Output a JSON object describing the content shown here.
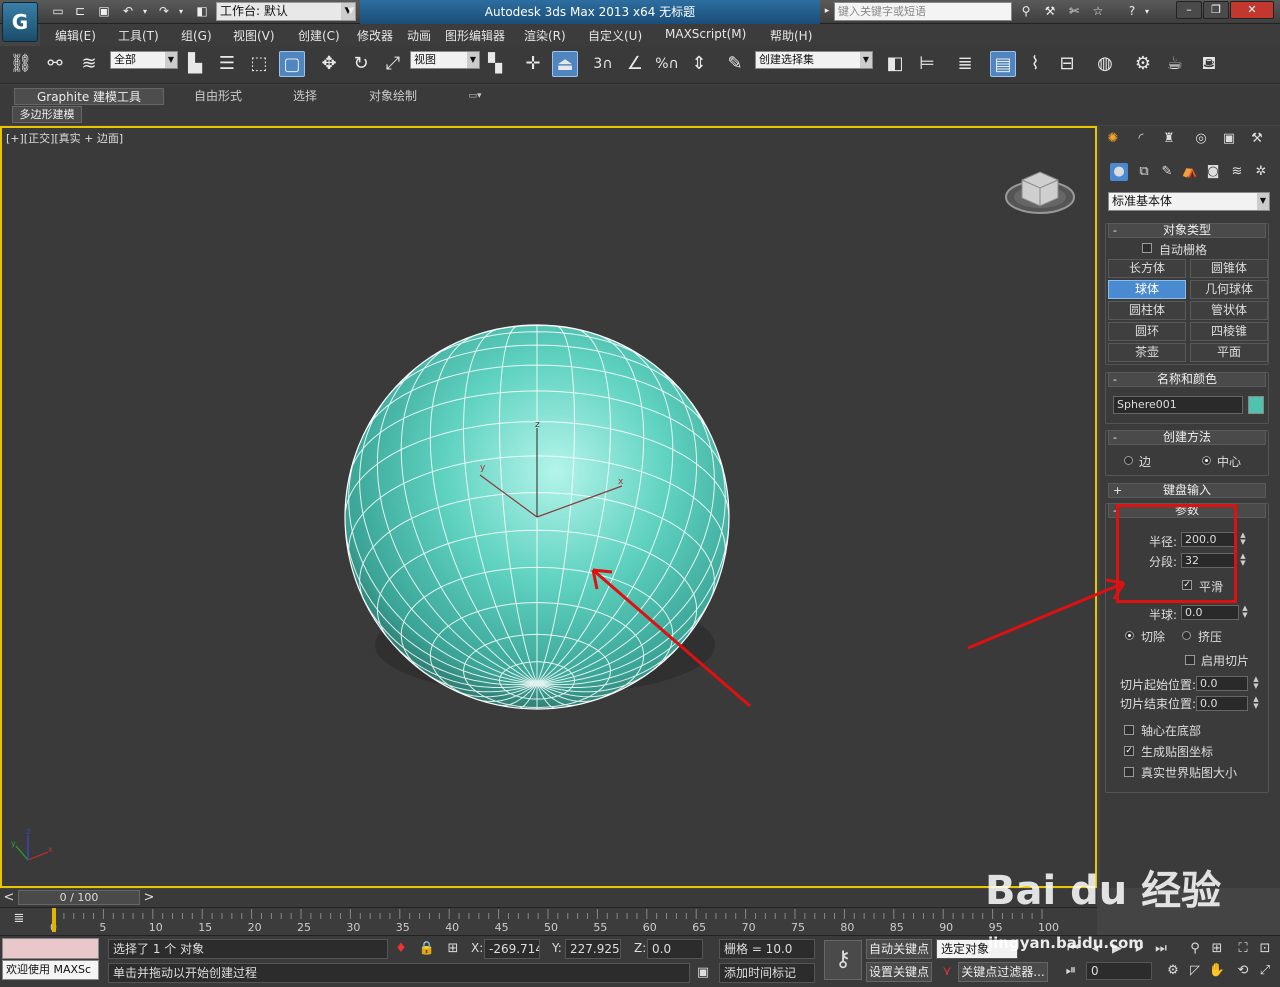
{
  "titlebar": {
    "app_title": "Autodesk 3ds Max  2013 x64",
    "file_title": "无标题",
    "workspace_label": "工作台: 默认",
    "search_placeholder": "键入关键字或短语",
    "logo": "G"
  },
  "menus": [
    "编辑(E)",
    "工具(T)",
    "组(G)",
    "视图(V)",
    "创建(C)",
    "修改器",
    "动画",
    "图形编辑器",
    "渲染(R)",
    "自定义(U)",
    "MAXScript(M)",
    "帮助(H)"
  ],
  "toolbar": {
    "selection_filter": "全部",
    "ref_coord": "视图",
    "named_selection": "创建选择集",
    "snap_label": "3",
    "angle_label": "%"
  },
  "ribbon": {
    "tabs": [
      "Graphite 建模工具",
      "自由形式",
      "选择",
      "对象绘制"
    ],
    "sub_label": "多边形建模"
  },
  "viewport": {
    "label": "[+][正交][真实 + 边面]",
    "gizmo_x": "x",
    "gizmo_y": "y",
    "gizmo_z": "z",
    "axis_x": "x",
    "axis_y": "y",
    "axis_z": "z",
    "sphere_color": "#4fc2b0"
  },
  "command_panel": {
    "category_dropdown": "标准基本体",
    "object_type": {
      "title": "对象类型",
      "autogrid": "自动栅格",
      "buttons": [
        "长方体",
        "圆锥体",
        "球体",
        "几何球体",
        "圆柱体",
        "管状体",
        "圆环",
        "四棱锥",
        "茶壶",
        "平面"
      ],
      "active": "球体"
    },
    "name_color": {
      "title": "名称和颜色",
      "name": "Sphere001",
      "color": "#4fc2b0"
    },
    "creation_method": {
      "title": "创建方法",
      "edge": "边",
      "center": "中心"
    },
    "keyboard_entry": {
      "title": "键盘输入"
    },
    "parameters": {
      "title": "参数",
      "radius_label": "半径:",
      "radius": "200.0",
      "segments_label": "分段:",
      "segments": "32",
      "smooth_label": "平滑",
      "hemisphere_label": "半球:",
      "hemisphere": "0.0",
      "chop": "切除",
      "squash": "挤压",
      "slice_on": "启用切片",
      "slice_from_label": "切片起始位置:",
      "slice_from": "0.0",
      "slice_to_label": "切片结束位置:",
      "slice_to": "0.0",
      "base_to_pivot": "轴心在底部",
      "gen_mapping": "生成贴图坐标",
      "real_world": "真实世界贴图大小"
    }
  },
  "timeline": {
    "frame_display": "0 / 100",
    "ticks": [
      "0",
      "5",
      "10",
      "15",
      "20",
      "25",
      "30",
      "35",
      "40",
      "45",
      "50",
      "55",
      "60",
      "65",
      "70",
      "75",
      "80",
      "85",
      "90",
      "95",
      "100"
    ]
  },
  "status": {
    "selection": "选择了 1 个 对象",
    "prompt": "单击并拖动以开始创建过程",
    "x_label": "X:",
    "x": "-269.714",
    "y_label": "Y:",
    "y": "227.925",
    "z_label": "Z:",
    "z": "0.0",
    "grid": "栅格 = 10.0",
    "auto_key": "自动关键点",
    "set_key": "设置关键点",
    "key_mode": "选定对象",
    "key_filters": "关键点过滤器...",
    "add_time_tag": "添加时间标记",
    "welcome": "欢迎使用 MAXSc",
    "frame": "0"
  },
  "watermark": {
    "brand": "Bai du 经验",
    "url": "jingyan.baidu.com"
  }
}
